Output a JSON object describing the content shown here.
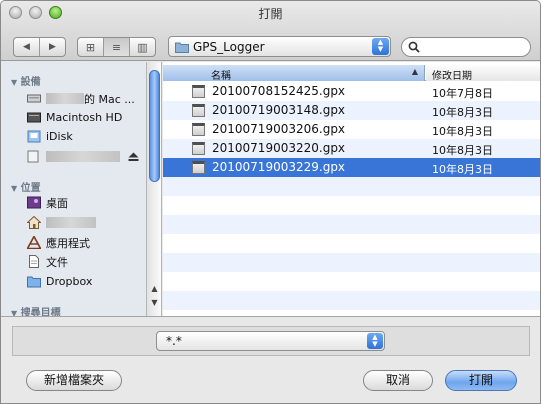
{
  "window": {
    "title": "打開"
  },
  "toolbar": {
    "back_label": "◀",
    "forward_label": "▶",
    "views": [
      "⊞",
      "≡",
      "▥"
    ],
    "location": "GPS_Logger",
    "search_placeholder": ""
  },
  "sidebar": {
    "devices_header": "設備",
    "places_header": "位置",
    "search_header": "搜尋目標",
    "devices": [
      {
        "label": "的 Mac ...",
        "icon": "computer-icon"
      },
      {
        "label": "Macintosh HD",
        "icon": "hard-drive-icon"
      },
      {
        "label": "iDisk",
        "icon": "idisk-icon"
      },
      {
        "label": "",
        "icon": "drive-icon"
      }
    ],
    "places": [
      {
        "label": "桌面",
        "icon": "desktop-icon"
      },
      {
        "label": "",
        "icon": "home-icon"
      },
      {
        "label": "應用程式",
        "icon": "applications-icon"
      },
      {
        "label": "文件",
        "icon": "documents-icon"
      },
      {
        "label": "Dropbox",
        "icon": "dropbox-icon"
      }
    ]
  },
  "file_list": {
    "col_name": "名稱",
    "col_date": "修改日期",
    "rows": [
      {
        "name": "20100708152425.gpx",
        "date": "10年7月8日"
      },
      {
        "name": "20100719003148.gpx",
        "date": "10年8月3日"
      },
      {
        "name": "20100719003206.gpx",
        "date": "10年8月3日"
      },
      {
        "name": "20100719003220.gpx",
        "date": "10年8月3日"
      },
      {
        "name": "20100719003229.gpx",
        "date": "10年8月3日"
      }
    ],
    "selected_index": 4
  },
  "format": {
    "value": "*.*"
  },
  "buttons": {
    "new_folder": "新增檔案夾",
    "cancel": "取消",
    "open": "打開"
  },
  "colors": {
    "selection": "#3875d7",
    "accent": "#4a86e4"
  }
}
